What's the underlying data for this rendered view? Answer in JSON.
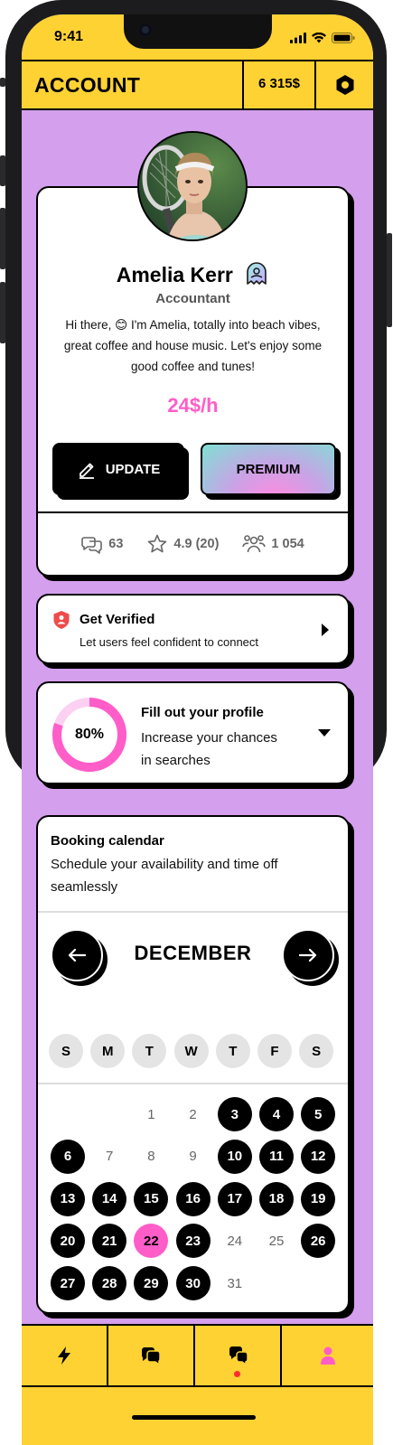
{
  "status_bar": {
    "time": "9:41"
  },
  "header": {
    "title": "ACCOUNT",
    "balance": "6 315$"
  },
  "profile": {
    "name": "Amelia Kerr",
    "role": "Accountant",
    "bio": "Hi there, 😊 I'm Amelia, totally into beach vibes, great coffee and house music. Let's enjoy some good coffee and tunes!",
    "rate": "24$/h",
    "update_label": "UPDATE",
    "premium_label": "PREMIUM",
    "stats": {
      "messages": "63",
      "rating": "4.9 (20)",
      "followers": "1 054"
    }
  },
  "verify": {
    "title": "Get Verified",
    "subtitle": "Let users feel confident to connect"
  },
  "profile_completion": {
    "percent_label": "80%",
    "percent": 80,
    "title": "Fill out your profile",
    "subtitle": "Increase your chances in searches"
  },
  "calendar": {
    "title": "Booking calendar",
    "subtitle": "Schedule your availability and time off seamlessly",
    "month": "DECEMBER",
    "weekdays": [
      "S",
      "M",
      "T",
      "W",
      "T",
      "F",
      "S"
    ],
    "days": [
      {
        "d": "1",
        "state": "free"
      },
      {
        "d": "2",
        "state": "free"
      },
      {
        "d": "3",
        "state": "busy"
      },
      {
        "d": "4",
        "state": "busy"
      },
      {
        "d": "5",
        "state": "busy"
      },
      {
        "d": "6",
        "state": "busy"
      },
      {
        "d": "7",
        "state": "free"
      },
      {
        "d": "8",
        "state": "free"
      },
      {
        "d": "9",
        "state": "free"
      },
      {
        "d": "10",
        "state": "busy"
      },
      {
        "d": "11",
        "state": "busy"
      },
      {
        "d": "12",
        "state": "busy"
      },
      {
        "d": "13",
        "state": "busy"
      },
      {
        "d": "14",
        "state": "busy"
      },
      {
        "d": "15",
        "state": "busy"
      },
      {
        "d": "16",
        "state": "busy"
      },
      {
        "d": "17",
        "state": "busy"
      },
      {
        "d": "18",
        "state": "busy"
      },
      {
        "d": "19",
        "state": "busy"
      },
      {
        "d": "20",
        "state": "busy"
      },
      {
        "d": "21",
        "state": "busy"
      },
      {
        "d": "22",
        "state": "today"
      },
      {
        "d": "23",
        "state": "busy"
      },
      {
        "d": "24",
        "state": "free"
      },
      {
        "d": "25",
        "state": "free"
      },
      {
        "d": "26",
        "state": "busy"
      },
      {
        "d": "27",
        "state": "busy"
      },
      {
        "d": "28",
        "state": "busy"
      },
      {
        "d": "29",
        "state": "busy"
      },
      {
        "d": "30",
        "state": "busy"
      },
      {
        "d": "31",
        "state": "free"
      }
    ],
    "first_weekday_index": 2
  },
  "tabbar": {
    "tabs": [
      {
        "icon": "lightning-icon"
      },
      {
        "icon": "chat-bubbles-icon"
      },
      {
        "icon": "messages-icon",
        "has_notification": true
      },
      {
        "icon": "user-profile-icon",
        "active": true
      }
    ]
  },
  "colors": {
    "yellow": "#FFD234",
    "lilac": "#D49FEC",
    "pink": "#FF5DC8"
  }
}
